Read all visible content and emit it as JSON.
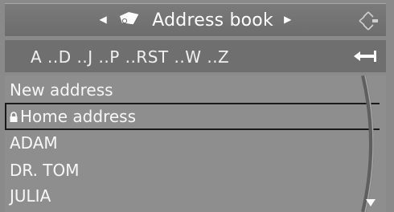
{
  "header": {
    "title": "Address book",
    "left_arrow_icon": "triangle-left",
    "right_arrow_icon": "triangle-right",
    "book_icon": "address-book-icon",
    "corner_icon": "controller-icon"
  },
  "alphabet": {
    "text": "A ..D ..J ..P ..RST ..W ..Z",
    "back_icon": "return-arrow-icon"
  },
  "list": {
    "items": [
      {
        "label": "New address",
        "selected": false,
        "icon": ""
      },
      {
        "label": "Home address",
        "selected": true,
        "icon": "lock-icon"
      },
      {
        "label": "ADAM",
        "selected": false,
        "icon": ""
      },
      {
        "label": "DR. TOM",
        "selected": false,
        "icon": ""
      },
      {
        "label": "JULIA",
        "selected": false,
        "icon": ""
      }
    ],
    "scroll_icon": "scroll-down-arrow-icon"
  },
  "colors": {
    "background": "#8c8c8c",
    "titlebar": "#727272",
    "alphabar": "#6f6f6f",
    "text": "#ffffff",
    "selection_border": "#1a1a1a"
  }
}
